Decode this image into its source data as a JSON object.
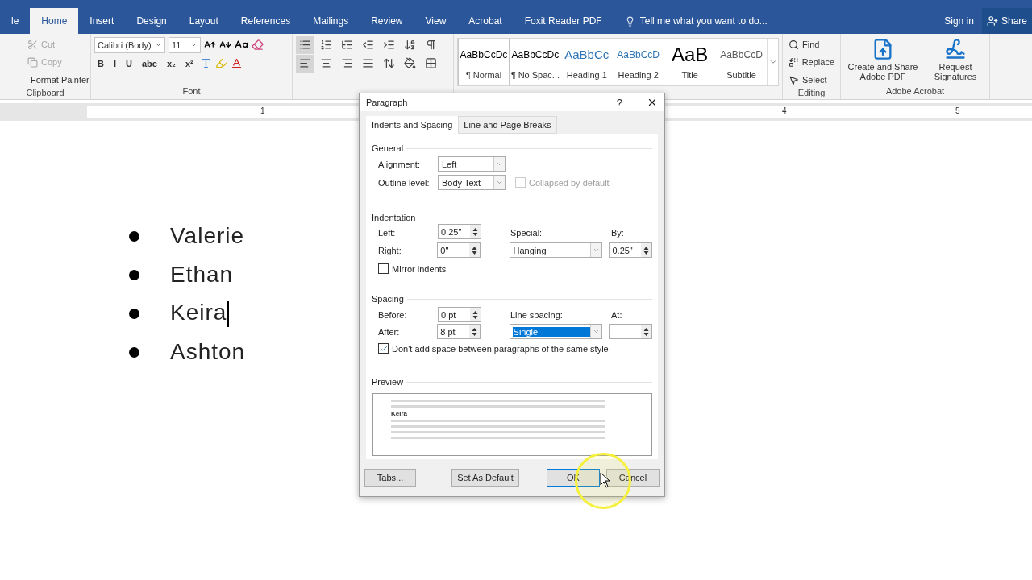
{
  "ribbon_tabs": [
    {
      "label": "le",
      "selected": false
    },
    {
      "label": "Home",
      "selected": true
    },
    {
      "label": "Insert",
      "selected": false
    },
    {
      "label": "Design",
      "selected": false
    },
    {
      "label": "Layout",
      "selected": false
    },
    {
      "label": "References",
      "selected": false
    },
    {
      "label": "Mailings",
      "selected": false
    },
    {
      "label": "Review",
      "selected": false
    },
    {
      "label": "View",
      "selected": false
    },
    {
      "label": "Acrobat",
      "selected": false
    },
    {
      "label": "Foxit Reader PDF",
      "selected": false
    }
  ],
  "tell_me": "Tell me what you want to do...",
  "sign_in": "Sign in",
  "share": "Share",
  "clipboard": {
    "label": "Clipboard",
    "items": [
      {
        "kind": "cut",
        "label": "Cut",
        "disabled": true
      },
      {
        "kind": "copy",
        "label": "Copy",
        "disabled": true
      },
      {
        "kind": "painter",
        "label": "Format Painter",
        "disabled": false
      }
    ]
  },
  "font": {
    "label": "Font",
    "name": "Calibri (Body)",
    "size": "11",
    "format_buttons": [
      "B",
      "I",
      "U",
      "abc",
      "x₂",
      "x²"
    ]
  },
  "styles": [
    {
      "sample": "AaBbCcDc",
      "name": "¶ Normal",
      "kind": "body",
      "selected": true
    },
    {
      "sample": "AaBbCcDc",
      "name": "¶ No Spac...",
      "kind": "body",
      "selected": false
    },
    {
      "sample": "AaBbCc",
      "name": "Heading 1",
      "kind": "heading1",
      "selected": false
    },
    {
      "sample": "AaBbCcD",
      "name": "Heading 2",
      "kind": "heading2",
      "selected": false
    },
    {
      "sample": "AaB",
      "name": "Title",
      "kind": "title",
      "selected": false
    },
    {
      "sample": "AaBbCcD",
      "name": "Subtitle",
      "kind": "subtitle",
      "selected": false
    }
  ],
  "editing": {
    "label": "Editing",
    "items": [
      {
        "kind": "find",
        "label": "Find"
      },
      {
        "kind": "replace",
        "label": "Replace"
      },
      {
        "kind": "select",
        "label": "Select"
      }
    ]
  },
  "acrobat": {
    "label": "Adobe Acrobat",
    "items": [
      {
        "kind": "create",
        "label": "Create and Share Adobe PDF"
      },
      {
        "kind": "sign",
        "label": "Request Signatures"
      }
    ]
  },
  "ruler_numbers": [
    "1",
    "4",
    "5"
  ],
  "document": {
    "bullets": [
      {
        "text": "Valerie",
        "caret": false
      },
      {
        "text": "Ethan",
        "caret": false
      },
      {
        "text": "Keira",
        "caret": true
      },
      {
        "text": "Ashton",
        "caret": false
      }
    ]
  },
  "dialog": {
    "title": "Paragraph",
    "help": "?",
    "tabs": [
      {
        "label": "Indents and Spacing",
        "selected": true
      },
      {
        "label": "Line and Page Breaks",
        "selected": false
      }
    ],
    "general": {
      "heading": "General",
      "alignment": {
        "label": "Alignment:",
        "value": "Left"
      },
      "outline": {
        "label": "Outline level:",
        "value": "Body Text"
      },
      "collapsed": {
        "label": "Collapsed by default",
        "checked": false,
        "disabled": true
      }
    },
    "indentation": {
      "heading": "Indentation",
      "left": {
        "label": "Left:",
        "value": "0.25\""
      },
      "right": {
        "label": "Right:",
        "value": "0\""
      },
      "special": {
        "label": "Special:",
        "value": "Hanging"
      },
      "by": {
        "label": "By:",
        "value": "0.25\""
      },
      "mirror": {
        "label": "Mirror indents",
        "checked": false
      }
    },
    "spacing": {
      "heading": "Spacing",
      "before": {
        "label": "Before:",
        "value": "0 pt"
      },
      "after": {
        "label": "After:",
        "value": "8 pt"
      },
      "line_spacing": {
        "label": "Line spacing:",
        "value": "Single",
        "selected": true
      },
      "at": {
        "label": "At:"
      },
      "dont_add": {
        "label": "Don't add space between paragraphs of the same style",
        "checked": true
      }
    },
    "preview": {
      "heading": "Preview",
      "current": "Keira"
    },
    "buttons": [
      {
        "kind": "tabs",
        "label": "Tabs..."
      },
      {
        "kind": "default",
        "label": "Set As Default"
      },
      {
        "kind": "ok",
        "label": "OK"
      },
      {
        "kind": "cancel",
        "label": "Cancel"
      }
    ]
  }
}
